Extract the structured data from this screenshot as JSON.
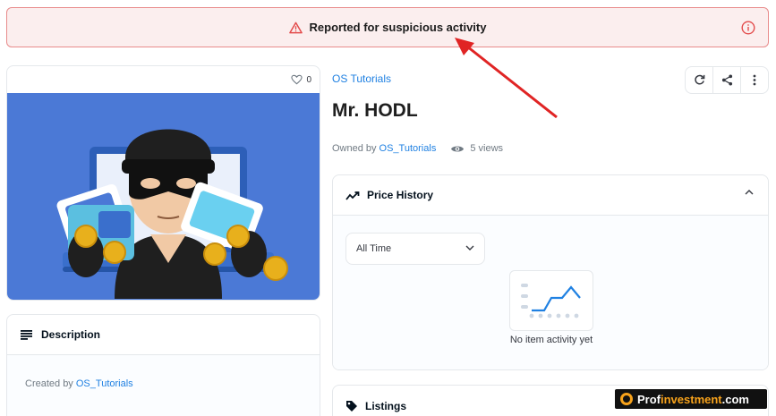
{
  "banner": {
    "text": "Reported for suspicious activity",
    "color": "#e34c4c"
  },
  "asset": {
    "favorites": "0",
    "collection": "OS Tutorials",
    "title": "Mr. HODL",
    "owned_by_label": "Owned by",
    "owner": "OS_Tutorials",
    "views": "5 views"
  },
  "description": {
    "heading": "Description",
    "created_by_label": "Created by",
    "creator": "OS_Tutorials"
  },
  "price_history": {
    "heading": "Price History",
    "filter": "All Time",
    "empty": "No item activity yet"
  },
  "listings": {
    "heading": "Listings"
  },
  "watermark": {
    "prefix": "Prof",
    "accent": "investment",
    "suffix": ".com"
  },
  "colors": {
    "link": "#2081e2",
    "image_bg": "#4b79d6",
    "accent_orange": "#f7a21b"
  },
  "icons": [
    "warning-icon",
    "info-icon",
    "heart-icon",
    "eye-icon",
    "refresh-icon",
    "share-icon",
    "more-icon",
    "description-icon",
    "trend-icon",
    "chevron-up-icon",
    "chevron-down-icon",
    "tag-icon"
  ]
}
